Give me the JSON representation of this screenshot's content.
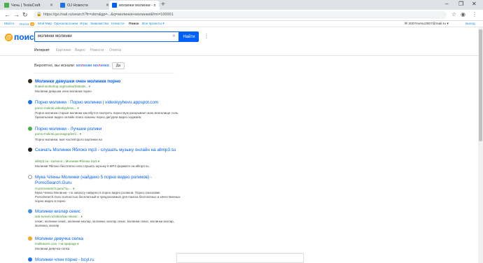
{
  "browser": {
    "tabs": [
      {
        "label": "Чечь | TeslaCraft",
        "active": false
      },
      {
        "label": "OJ Новости",
        "active": false
      },
      {
        "label": "молинки молинки - п",
        "active": true
      }
    ],
    "new_tab": "+",
    "url": "https://go.mail.ru/search?fr=vbm&gp=...&q=молинки+молинки&frm=100001"
  },
  "portal": {
    "links": [
      "Mail.ru",
      "Почта",
      "Мой Мир",
      "Одноклассники",
      "Игры",
      "Знакомства",
      "Новости",
      "Поиск",
      "Все проекты"
    ],
    "mail_badge": "25",
    "user": "2007mvmo2007@mail.ru",
    "logout": "выход"
  },
  "search": {
    "logo": "поиск",
    "query": "молинки молинки",
    "button": "Найти",
    "tabs": [
      "Интернет",
      "Картинки",
      "Видео",
      "Новости",
      "Ответы"
    ]
  },
  "suggest": {
    "prefix": "Вероятно, вы искали:",
    "hint_part1": "мо",
    "hint_err1": "л",
    "hint_part2": "инки мо",
    "hint_err2": "л",
    "hint_part3": "инки",
    "yes": "Да"
  },
  "results": [
    {
      "title": "Молинки девушки очен молинки порно",
      "url": "finalsil-workshop.org/molina/348448... ▾",
      "snippet": "Молинки девушки очен молинки порно",
      "icon_color": "#3b2a1a"
    },
    {
      "title": "Порно молинки : Порно молинки | videokyyhevu.appspot.com",
      "url": "porno-molinki.videokyyhevu... ▾",
      "snippet": "Порно молинки старые молинки как вбутся смотреть порно муж раскрывает мою влагалище соль бразильские видео онлайн поиск кожаны порно дисуреи видео ходжаев.",
      "icon_color": "#1a73e8"
    },
    {
      "title": "Порно молинки - Лучшие ролики",
      "url": "porno-molinki.gorosagzqdvmi... ▾",
      "snippet": "Порно молинки, моя частей фото картинки на",
      "icon_color": "#4caf50"
    },
    {
      "title": "Скачать Молинки Яблоко mp3 - слушать музыку онлайн на allmp3.su",
      "url": "allmp3.su › Каталог › Молинки Яблоко mp3 ▾",
      "snippet": "Молинки Яблоко бесплатно или слушать музыку в MP3 формате на allmp3.su",
      "icon_color": "#222222"
    },
    {
      "title": "Мука Члены Молинки (найдено 5 порно видео роликов) - PornoSearch.Guru",
      "url": "rs.pornosearch.guru/?q=... ▾",
      "snippet": "Мука Члены Молинки - по запросу найдено 5 порно видео роликов. Порно поисковик PornoSearch.Guru полностью бесплатный и предлагаемые для поиска бесплатных и качественных порно видео в порно",
      "icon_color": "#ffffff"
    },
    {
      "title": "Молинки кизлар секис",
      "url": "anti-tunnel.ru/video/kav-sikesi/... ▾",
      "snippet": "секис, молинки секис, молинки кизлар, молинки, кизлар секис, молинки секис, молинки кизлар, молинка, кизлар",
      "icon_color": "#4a90e2"
    },
    {
      "title": "Молинки девучка селка",
      "url": "molikavers.com › на природе ▾",
      "snippet": "Молинки девучка селка",
      "icon_color": "#f5a623"
    },
    {
      "title": "Молинки член порно - bcyl.ru",
      "url": "",
      "snippet": "",
      "icon_color": "#1a73e8"
    }
  ]
}
